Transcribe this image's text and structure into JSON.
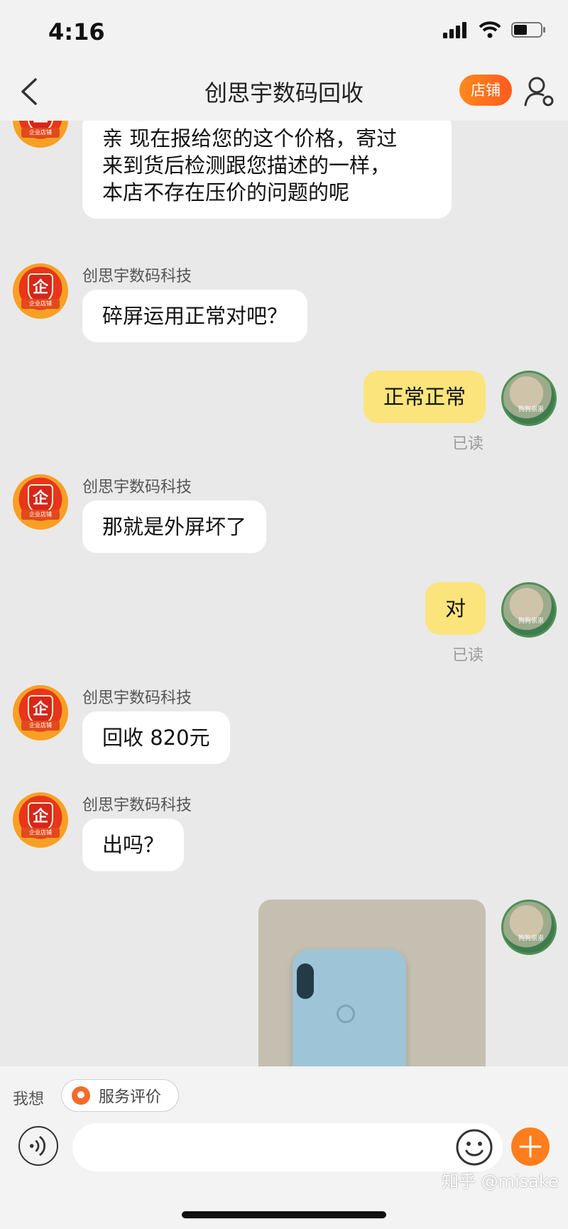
{
  "status_bar": {
    "time": "4:16"
  },
  "nav": {
    "title": "创思宇数码回收",
    "store_label": "店铺"
  },
  "shop": {
    "name": "创思宇数码科技",
    "badge": "企",
    "ribbon": "企业店铺"
  },
  "user": {
    "avatar_caption": "狗狗祟祟"
  },
  "messages": [
    {
      "from": "shop",
      "text": "亲 现在报给您的这个价格，寄过\n来到货后检测跟您描述的一样，\n本店不存在压价的问题的呢"
    },
    {
      "from": "shop",
      "text": "碎屏运用正常对吧？"
    },
    {
      "from": "me",
      "text": "正常正常",
      "status": "已读"
    },
    {
      "from": "shop",
      "text": "那就是外屏坏了"
    },
    {
      "from": "me",
      "text": "对",
      "status": "已读"
    },
    {
      "from": "shop",
      "text": "回收 820元"
    },
    {
      "from": "shop",
      "text": "出吗？"
    },
    {
      "from": "me",
      "type": "image"
    }
  ],
  "bottom": {
    "want_label": "我想",
    "review_label": "服务评价",
    "input_placeholder": ""
  },
  "watermark": "知乎 @misake"
}
